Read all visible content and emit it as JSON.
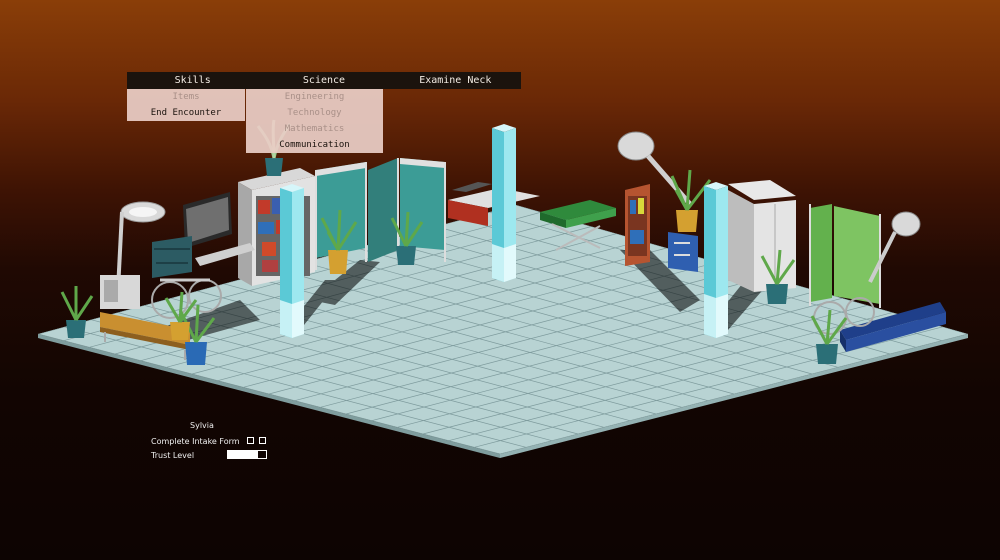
{
  "menu": {
    "tabs": [
      {
        "label": "Skills"
      },
      {
        "label": "Science"
      },
      {
        "label": "Examine Neck"
      }
    ],
    "skills_items": [
      {
        "label": "Items",
        "enabled": false
      },
      {
        "label": "End Encounter",
        "enabled": true
      }
    ],
    "science_items": [
      {
        "label": "Engineering",
        "enabled": false
      },
      {
        "label": "Technology",
        "enabled": false
      },
      {
        "label": "Mathematics",
        "enabled": false
      },
      {
        "label": "Communication",
        "enabled": true
      }
    ]
  },
  "hud": {
    "patient_name": "Sylvia",
    "task_label": "Complete Intake Form",
    "task_checkboxes": [
      false,
      false
    ],
    "trust_label": "Trust Level",
    "trust_level": 0.8
  },
  "colors": {
    "sky_top": "#8a3e08",
    "floor": "#b8d3d3",
    "grid": "#7d9a9c",
    "pillar": "#8fe0ea",
    "curtain": "#3c9c96",
    "curtain_green": "#63b14d",
    "menu_bg": "#1b130d",
    "submenu_bg": "#e9cec6"
  }
}
